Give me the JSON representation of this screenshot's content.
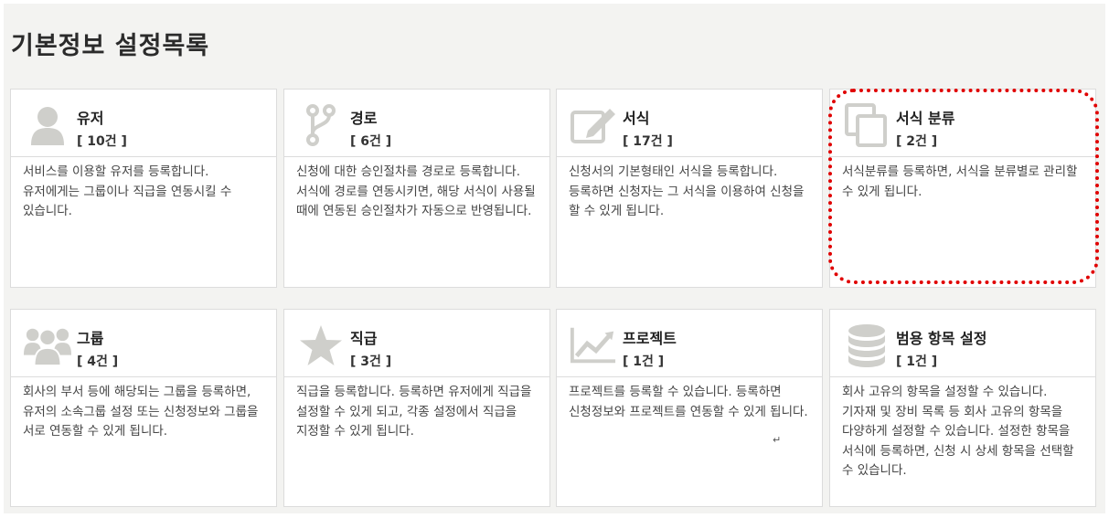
{
  "page": {
    "title": "기본정보 설정목록"
  },
  "colors": {
    "icon": "#cfcfcb",
    "highlight": "#e00000"
  },
  "cards": [
    {
      "title": "유저",
      "count": "[ 10건 ]",
      "icon": "user-icon",
      "desc": "서비스를 이용할 유저를 등록합니다. 유저에게는 그룹이나 직급을 연동시킬 수 있습니다."
    },
    {
      "title": "경로",
      "count": "[ 6건 ]",
      "icon": "branch-icon",
      "desc": "신청에 대한 승인절차를 경로로 등록합니다. 서식에 경로를 연동시키면, 해당 서식이 사용될 때에 연동된 승인절차가 자동으로 반영됩니다."
    },
    {
      "title": "서식",
      "count": "[ 17건 ]",
      "icon": "edit-form-icon",
      "desc": "신청서의 기본형태인 서식을 등록합니다. 등록하면 신청자는 그 서식을 이용하여 신청을 할 수 있게 됩니다."
    },
    {
      "title": "서식 분류",
      "count": "[ 2건 ]",
      "icon": "copy-icon",
      "desc": "서식분류를 등록하면, 서식을 분류별로 관리할 수 있게 됩니다."
    },
    {
      "title": "그룹",
      "count": "[ 4건 ]",
      "icon": "group-icon",
      "desc": "회사의 부서 등에 해당되는 그룹을 등록하면, 유저의 소속그룹 설정 또는 신청정보와 그룹을 서로 연동할 수 있게 됩니다."
    },
    {
      "title": "직급",
      "count": "[ 3건 ]",
      "icon": "star-icon",
      "desc": "직급을 등록합니다. 등록하면 유저에게 직급을 설정할 수 있게 되고, 각종 설정에서 직급을 지정할 수 있게 됩니다."
    },
    {
      "title": "프로젝트",
      "count": "[ 1건 ]",
      "icon": "line-chart-icon",
      "desc": "프로젝트를 등록할 수 있습니다. 등록하면 신청정보와 프로젝트를 연동할 수 있게 됩니다."
    },
    {
      "title": "범용 항목 설정",
      "count": "[ 1건 ]",
      "icon": "database-icon",
      "desc": "회사 고유의 항목을 설정할 수 있습니다. 기자재 및 장비 목록 등 회사 고유의 항목을 다양하게 설정할 수 있습니다. 설정한 항목을 서식에 등록하면, 신청 시 상세 항목을 선택할 수 있습니다."
    }
  ],
  "mark": "↵"
}
